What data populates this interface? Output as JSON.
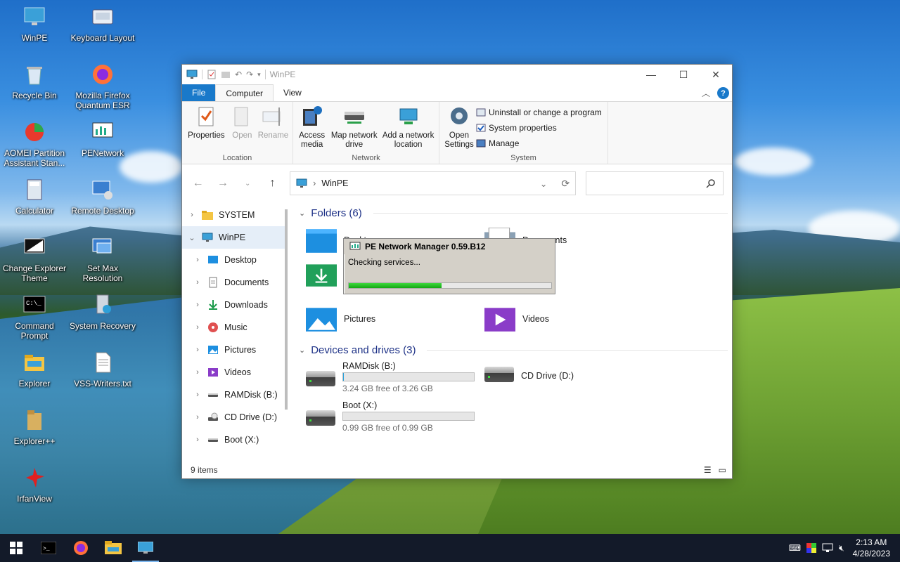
{
  "desktop": {
    "icons": [
      {
        "label": "WinPE",
        "icon": "monitor-icon"
      },
      {
        "label": "Keyboard Layout",
        "icon": "keyboard-icon"
      },
      {
        "label": "Recycle Bin",
        "icon": "recycle-bin-icon"
      },
      {
        "label": "Mozilla Firefox Quantum ESR",
        "icon": "firefox-icon"
      },
      {
        "label": "AOMEI Partition Assistant Stan...",
        "icon": "aomei-icon"
      },
      {
        "label": "PENetwork",
        "icon": "network-icon"
      },
      {
        "label": "Calculator",
        "icon": "calculator-icon"
      },
      {
        "label": "Remote Desktop",
        "icon": "remote-desktop-icon"
      },
      {
        "label": "Change Explorer Theme",
        "icon": "theme-icon"
      },
      {
        "label": "Set Max Resolution",
        "icon": "resolution-icon"
      },
      {
        "label": "Command Prompt",
        "icon": "cmd-icon"
      },
      {
        "label": "System Recovery",
        "icon": "recovery-icon"
      },
      {
        "label": "Explorer",
        "icon": "folder-icon"
      },
      {
        "label": "VSS-Writers.txt",
        "icon": "text-file-icon"
      },
      {
        "label": "Explorer++",
        "icon": "explorerpp-icon"
      },
      {
        "label": "IrfanView",
        "icon": "irfanview-icon"
      }
    ]
  },
  "window": {
    "title": "WinPE",
    "tabs": {
      "file": "File",
      "computer": "Computer",
      "view": "View"
    },
    "ribbon": {
      "location": {
        "name": "Location",
        "properties": "Properties",
        "open": "Open",
        "rename": "Rename"
      },
      "network": {
        "name": "Network",
        "access_media": "Access media",
        "map_network_drive": "Map network drive",
        "add_network_location": "Add a network location"
      },
      "system": {
        "name": "System",
        "open_settings": "Open Settings",
        "uninstall": "Uninstall or change a program",
        "system_properties": "System properties",
        "manage": "Manage"
      }
    },
    "address": {
      "path": "WinPE"
    },
    "nav": [
      {
        "label": "SYSTEM",
        "icon": "folder-icon"
      },
      {
        "label": "WinPE",
        "icon": "monitor-icon"
      },
      {
        "label": "Desktop",
        "icon": "desktop-icon"
      },
      {
        "label": "Documents",
        "icon": "documents-icon"
      },
      {
        "label": "Downloads",
        "icon": "downloads-icon"
      },
      {
        "label": "Music",
        "icon": "music-icon"
      },
      {
        "label": "Pictures",
        "icon": "pictures-icon"
      },
      {
        "label": "Videos",
        "icon": "videos-icon"
      },
      {
        "label": "RAMDisk (B:)",
        "icon": "drive-icon"
      },
      {
        "label": "CD Drive (D:)",
        "icon": "cd-drive-icon"
      },
      {
        "label": "Boot (X:)",
        "icon": "drive-icon"
      }
    ],
    "folders_header": "Folders (6)",
    "folders": [
      {
        "label": "Desktop"
      },
      {
        "label": "Documents"
      },
      {
        "label": "Downloads"
      },
      {
        "label": "Music"
      },
      {
        "label": "Pictures"
      },
      {
        "label": "Videos"
      }
    ],
    "drives_header": "Devices and drives (3)",
    "drives": [
      {
        "label": "RAMDisk (B:)",
        "free": "3.24 GB free of 3.26 GB",
        "used_fraction": 0.006
      },
      {
        "label": "CD Drive (D:)"
      },
      {
        "label": "Boot (X:)",
        "free": "0.99 GB free of 0.99 GB",
        "used_fraction": 0.0
      }
    ],
    "status": "9 items"
  },
  "dialog": {
    "title": "PE Network Manager 0.59.B12",
    "message": "Checking services...",
    "progress_fraction": 0.46
  },
  "taskbar": {
    "time": "2:13 AM",
    "date": "4/28/2023",
    "accent": "#7cb7ef"
  }
}
